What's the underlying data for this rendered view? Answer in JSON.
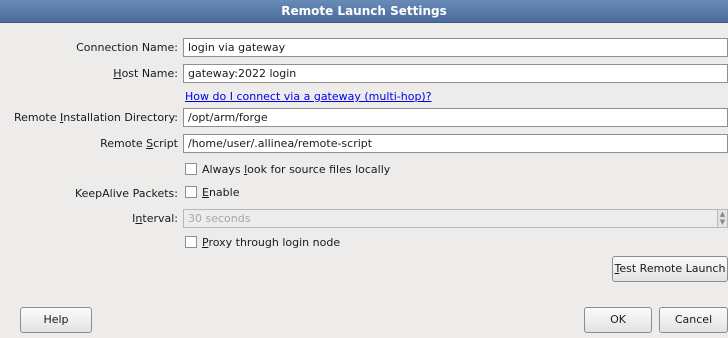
{
  "window": {
    "title": "Remote Launch Settings"
  },
  "form": {
    "connection_name": {
      "label": "Connection Name:",
      "value": "login via gateway"
    },
    "host_name": {
      "label_prefix": "",
      "label_mnemonic": "H",
      "label_suffix": "ost Name:",
      "value": "gateway:2022 login"
    },
    "gateway_help_link": "How do I connect via a gateway (multi-hop)?",
    "remote_installation_directory": {
      "label_prefix": "Remote ",
      "label_mnemonic": "I",
      "label_suffix": "nstallation Directory:",
      "value": "/opt/arm/forge"
    },
    "remote_script": {
      "label_prefix": "Remote ",
      "label_mnemonic": "S",
      "label_suffix": "cript",
      "value": "/home/user/.allinea/remote-script"
    },
    "always_look_locally": {
      "label_prefix": "Always ",
      "label_mnemonic": "l",
      "label_suffix": "ook for source files locally",
      "checked": false
    },
    "keepalive": {
      "label": "KeepAlive Packets:",
      "enable_mnemonic": "E",
      "enable_suffix": "nable",
      "checked": false
    },
    "interval": {
      "label_prefix": "I",
      "label_mnemonic": "n",
      "label_suffix": "terval:",
      "value": "30 seconds",
      "spin_up": "▲",
      "spin_down": "▼"
    },
    "proxy": {
      "label_prefix": "",
      "label_mnemonic": "P",
      "label_suffix": "roxy through login node",
      "checked": false
    }
  },
  "buttons": {
    "test_mnemonic": "T",
    "test_suffix": "est Remote Launch",
    "help": "Help",
    "ok": "OK",
    "cancel": "Cancel"
  }
}
